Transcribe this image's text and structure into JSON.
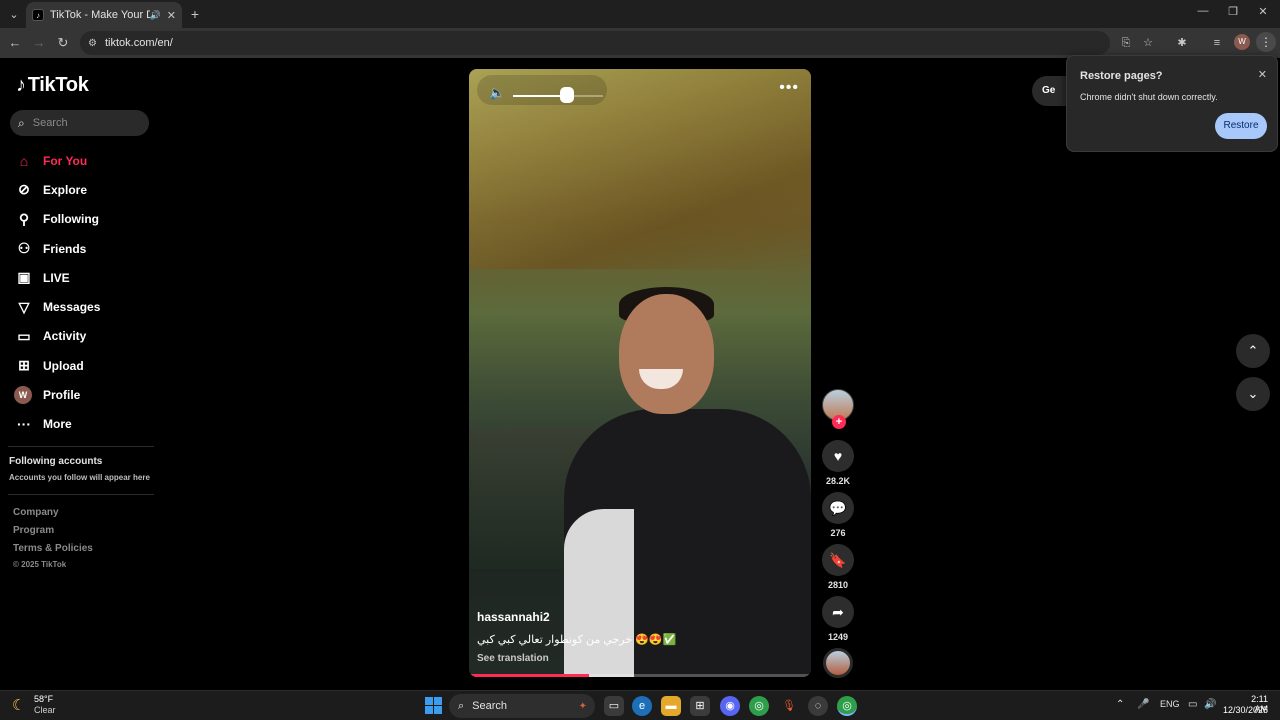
{
  "browser": {
    "tab_title": "TikTok - Make Your Day",
    "url": "tiktok.com/en/",
    "profile_initial": "W"
  },
  "sidebar": {
    "logo": "TikTok",
    "search_placeholder": "Search",
    "nav": [
      {
        "label": "For You",
        "icon": "home-icon",
        "active": true
      },
      {
        "label": "Explore",
        "icon": "compass-icon"
      },
      {
        "label": "Following",
        "icon": "following-icon"
      },
      {
        "label": "Friends",
        "icon": "friends-icon"
      },
      {
        "label": "LIVE",
        "icon": "live-icon"
      },
      {
        "label": "Messages",
        "icon": "messages-icon"
      },
      {
        "label": "Activity",
        "icon": "activity-icon"
      },
      {
        "label": "Upload",
        "icon": "upload-icon"
      },
      {
        "label": "Profile",
        "icon": "avatar",
        "initial": "W"
      },
      {
        "label": "More",
        "icon": "more-icon"
      }
    ],
    "following_title": "Following accounts",
    "following_sub": "Accounts you follow will appear here",
    "footer": [
      "Company",
      "Program",
      "Terms & Policies"
    ],
    "copyright": "© 2025 TikTok"
  },
  "video": {
    "author": "hassannahi2",
    "caption": "خرجي من كونطوار  تعالي كبي كبي 😍😍✅",
    "see_translation": "See translation",
    "volume_level": 0.6,
    "progress": 0.35
  },
  "actions": {
    "likes": "28.2K",
    "comments": "276",
    "saves": "2810",
    "shares": "1249"
  },
  "get_app_label": "Ge",
  "restore_popup": {
    "title": "Restore pages?",
    "message": "Chrome didn't shut down correctly.",
    "button": "Restore"
  },
  "taskbar": {
    "temp": "58°F",
    "condition": "Clear",
    "search": "Search",
    "lang": "ENG",
    "time": "2:11 AM",
    "date": "12/30/2025"
  },
  "colors": {
    "accent": "#fe2c55",
    "restore_button": "#a8c7fa"
  }
}
